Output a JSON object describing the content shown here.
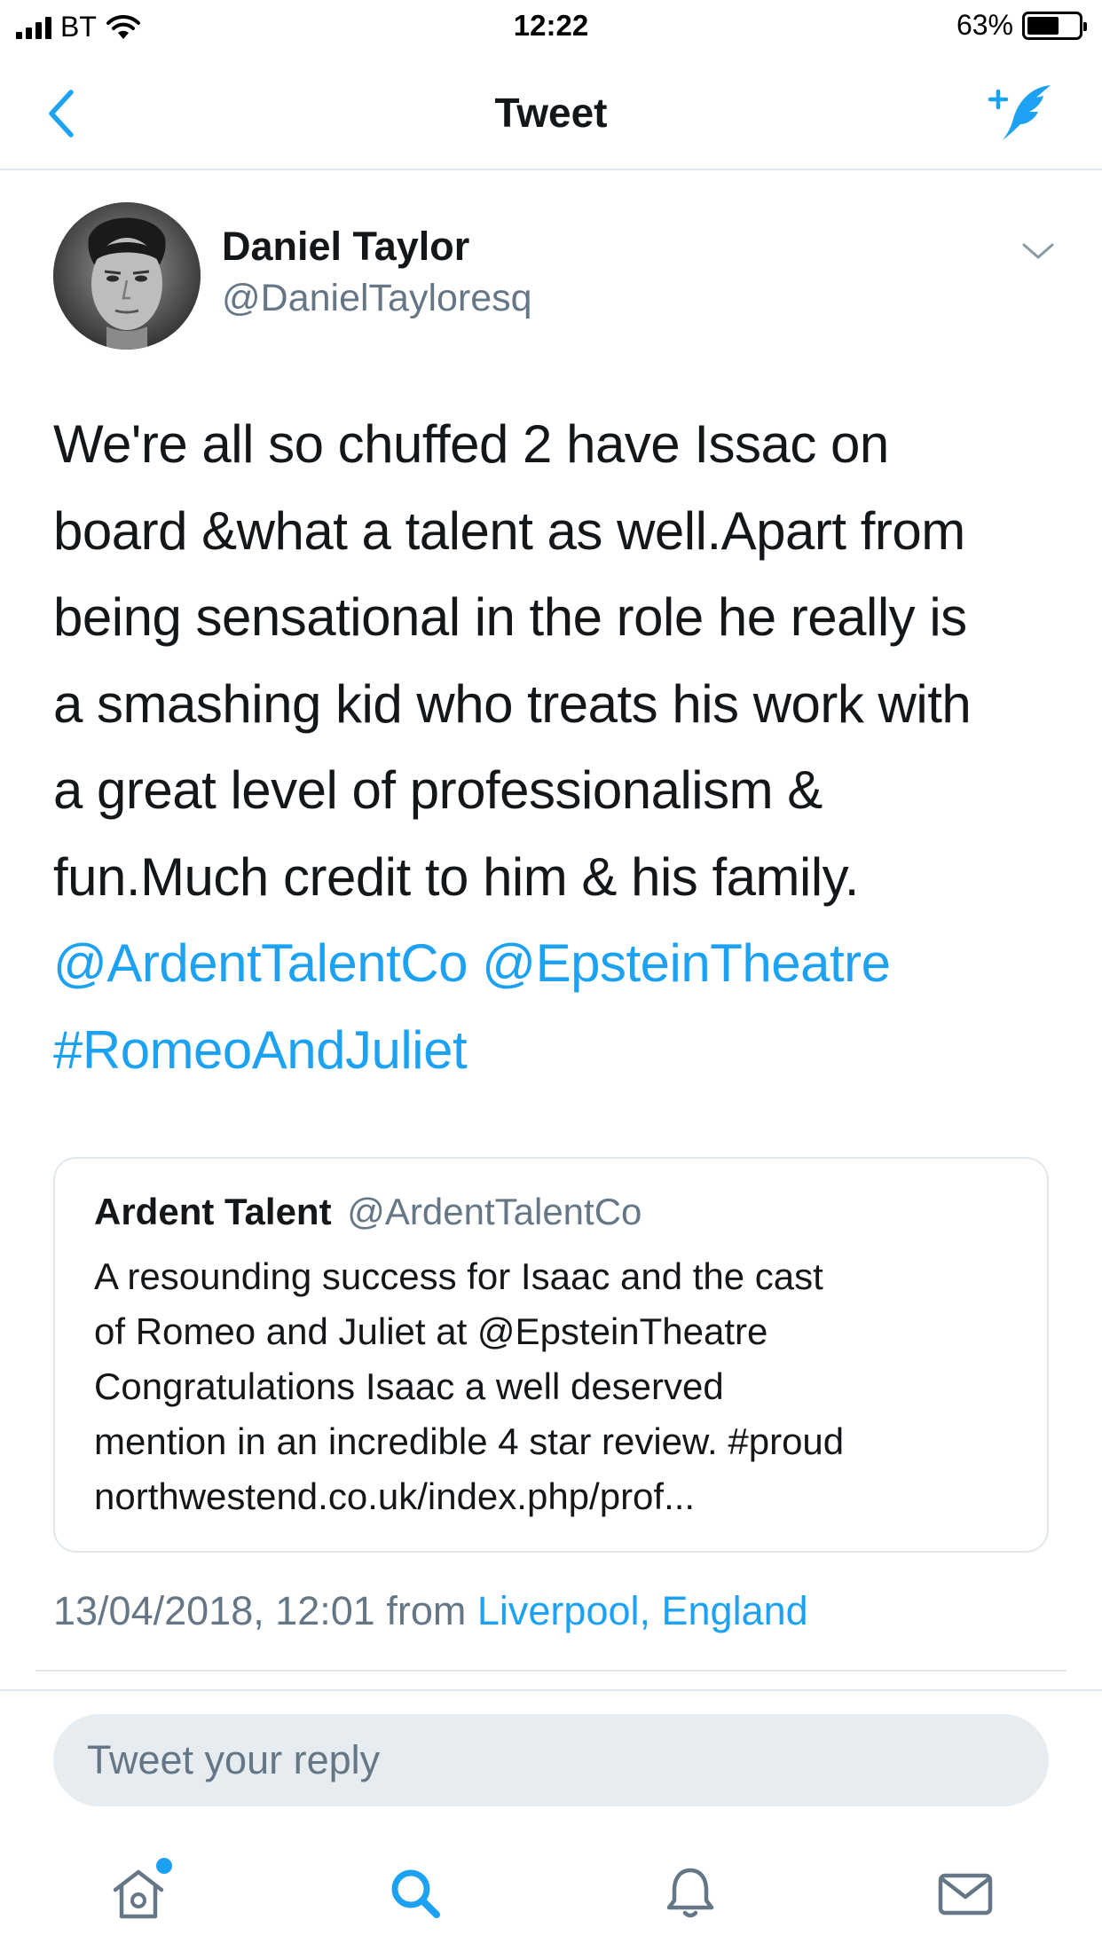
{
  "status_bar": {
    "carrier": "BT",
    "time": "12:22",
    "battery_percent": "63%",
    "battery_level": 0.63
  },
  "nav": {
    "title": "Tweet",
    "back_icon": "chevron-left-icon",
    "compose_icon": "compose-tweet-icon"
  },
  "tweet": {
    "author_name": "Daniel Taylor",
    "author_handle": "@DanielTayloresq",
    "text_lines": [
      "We're all so chuffed 2 have Issac on",
      "board &what a talent as well.Apart from",
      "being sensational in the role he really is",
      "a smashing kid who treats his work with",
      "a great level of professionalism &",
      "fun.Much credit to him & his family."
    ],
    "mention_1": "@ArdentTalentCo",
    "mention_2": "@EpsteinTheatre",
    "hashtag": "#RomeoAndJuliet",
    "timestamp": "13/04/2018, 12:01",
    "from_text": "from",
    "location": "Liverpool, England"
  },
  "quoted_tweet": {
    "author_name": "Ardent Talent",
    "author_handle": "@ArdentTalentCo",
    "text_lines": [
      "A resounding success for Isaac and the cast",
      "of Romeo and Juliet at @EpsteinTheatre",
      "Congratulations Isaac a well deserved",
      "mention in an incredible 4 star review. #proud",
      "northwestend.co.uk/index.php/prof..."
    ]
  },
  "reply": {
    "placeholder": "Tweet your reply"
  },
  "tab_bar": {
    "tabs": [
      "home-icon",
      "search-icon",
      "notifications-bell-icon",
      "messages-envelope-icon"
    ],
    "active_tab": "search-icon",
    "home_has_new": true
  },
  "colors": {
    "accent": "#1da1f2",
    "secondary_text": "#657786",
    "primary_text": "#14171a",
    "border": "#e1e8ed"
  }
}
